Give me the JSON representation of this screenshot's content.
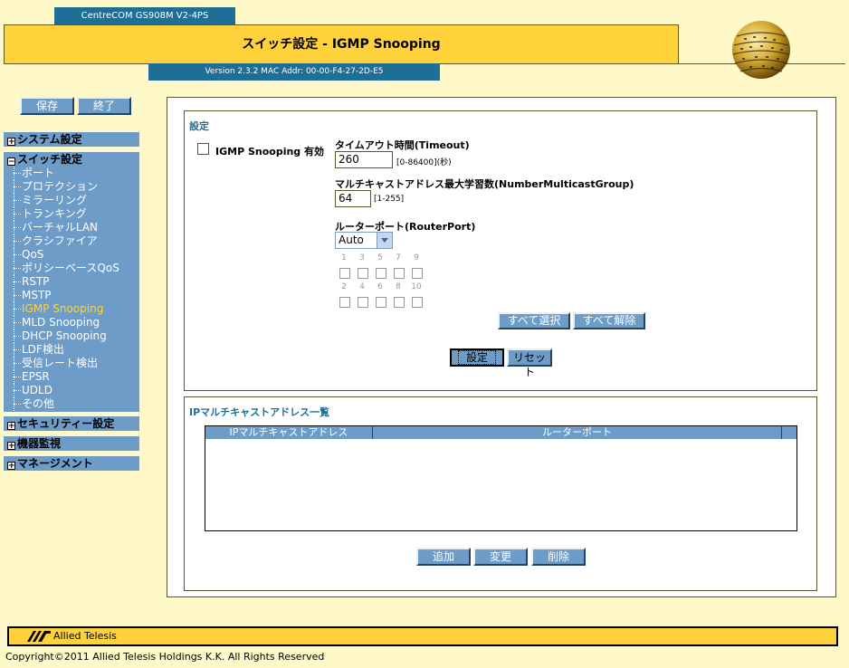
{
  "header": {
    "model": "CentreCOM GS908M V2-4PS",
    "title": "スイッチ設定 - IGMP Snooping",
    "version": "Version 2.3.2 MAC Addr: 00-00-F4-27-2D-E5"
  },
  "top_buttons": {
    "save": "保存",
    "exit": "終了"
  },
  "nav": {
    "groups": [
      "システム設定",
      "スイッチ設定",
      "セキュリティー設定",
      "機器監視",
      "マネージメント"
    ],
    "switch_items": [
      "ポート",
      "プロテクション",
      "ミラーリング",
      "トランキング",
      "バーチャルLAN",
      "クラシファイア",
      "QoS",
      "ポリシーベースQoS",
      "RSTP",
      "MSTP",
      "IGMP Snooping",
      "MLD Snooping",
      "DHCP Snooping",
      "LDF検出",
      "受信レート検出",
      "EPSR",
      "UDLD",
      "その他"
    ],
    "active": "IGMP Snooping"
  },
  "settings": {
    "section_title": "設定",
    "enable_label": "IGMP Snooping 有効",
    "timeout_label": "タイムアウト時間(Timeout)",
    "timeout_value": "260",
    "timeout_hint": "[0-86400](秒)",
    "max_group_label": "マルチキャストアドレス最大学習数(NumberMulticastGroup)",
    "max_group_value": "64",
    "max_group_hint": "[1-255]",
    "router_port_label": "ルーターポート(RouterPort)",
    "router_port_value": "Auto",
    "ports_top": [
      "1",
      "3",
      "5",
      "7",
      "9"
    ],
    "ports_bottom": [
      "2",
      "4",
      "6",
      "8",
      "10"
    ],
    "select_all": "すべて選択",
    "clear_all": "すべて解除",
    "apply": "設定",
    "reset": "リセット"
  },
  "list": {
    "section_title": "IPマルチキャストアドレス一覧",
    "columns": [
      "IPマルチキャストアドレス",
      "ルーターポート"
    ],
    "add": "追加",
    "modify": "変更",
    "delete": "削除"
  },
  "footer": {
    "brand": "Allied Telesis",
    "copyright": "Copyright©2011 Allied Telesis Holdings K.K. All Rights Reserved"
  },
  "colors": {
    "accent_yellow": "#ffd23c",
    "nav_blue": "#6d9cc8",
    "header_blue": "#1e6e96",
    "background": "#fff8c8"
  }
}
